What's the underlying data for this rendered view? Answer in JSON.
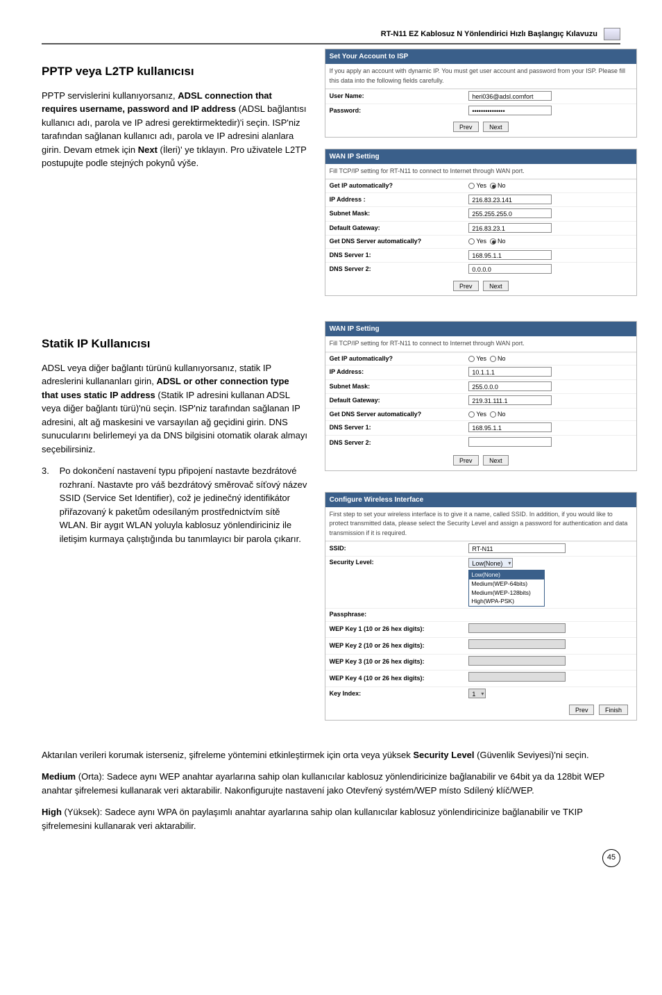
{
  "header": {
    "title": "RT-N11 EZ Kablosuz N Yönlendirici Hızlı Başlangıç Kılavuzu"
  },
  "section1": {
    "heading": "PPTP veya L2TP kullanıcısı",
    "para": "PPTP servislerini kullanıyorsanız, ADSL connection that requires username, password and IP address (ADSL bağlantısı kullanıcı adı, parola ve IP adresi gerektirmektedir)'i seçin. ISP'niz tarafından sağlanan kullanıcı adı, parola ve IP adresini alanlara girin. Devam etmek için Next (İleri)' ye tıklayın. Pro uživatele L2TP postupujte podle stejných pokynů výše.",
    "bold_phrases": {
      "b1": "ADSL connection that requires username, password and IP address",
      "b2": "Next"
    }
  },
  "panel_isp": {
    "title": "Set Your Account to ISP",
    "desc": "If you apply an account with dynamic IP. You must get user account and password from your ISP. Please fill this data into the following fields carefully.",
    "row1_lbl": "User Name:",
    "row1_val": "heri036@adsl.comfort",
    "row2_lbl": "Password:",
    "row2_val": "•••••••••••••••",
    "btn_prev": "Prev",
    "btn_next": "Next"
  },
  "panel_wan1": {
    "title": "WAN IP Setting",
    "desc": "Fill TCP/IP setting for RT-N11 to connect to Internet through WAN port.",
    "r1_lbl": "Get IP automatically?",
    "r1_yes": "Yes",
    "r1_no": "No",
    "r2_lbl": "IP Address :",
    "r2_val": "216.83.23.141",
    "r3_lbl": "Subnet Mask:",
    "r3_val": "255.255.255.0",
    "r4_lbl": "Default Gateway:",
    "r4_val": "216.83.23.1",
    "r5_lbl": "Get DNS Server automatically?",
    "r6_lbl": "DNS Server 1:",
    "r6_val": "168.95.1.1",
    "r7_lbl": "DNS Server 2:",
    "r7_val": "0.0.0.0",
    "btn_prev": "Prev",
    "btn_next": "Next"
  },
  "section2": {
    "heading": "Statik IP Kullanıcısı",
    "para": "ADSL veya diğer bağlantı türünü kullanıyorsanız, statik IP adreslerini kullananları girin, ADSL or other connection type that uses static IP address (Statik IP adresini kullanan ADSL veya diğer bağlantı türü)'nü seçin. ISP'niz tarafından sağlanan IP adresini, alt ağ maskesini ve varsayılan ağ geçidini girin. DNS sunucularını belirlemeyi ya da DNS bilgisini otomatik olarak almayı seçebilirsiniz.",
    "bold_phrase": "ADSL or other connection type that uses static IP address"
  },
  "panel_wan2": {
    "title": "WAN IP Setting",
    "desc": "Fill TCP/IP setting for RT-N11 to connect to Internet through WAN port.",
    "r1_lbl": "Get IP automatically?",
    "yes": "Yes",
    "no": "No",
    "r2_lbl": "IP Address:",
    "r2_val": "10.1.1.1",
    "r3_lbl": "Subnet Mask:",
    "r3_val": "255.0.0.0",
    "r4_lbl": "Default Gateway:",
    "r4_val": "219.31.111.1",
    "r5_lbl": "Get DNS Server automatically?",
    "r6_lbl": "DNS Server 1:",
    "r6_val": "168.95.1.1",
    "r7_lbl": "DNS Server 2:",
    "r7_val": "",
    "btn_prev": "Prev",
    "btn_next": "Next"
  },
  "item3": {
    "num": "3.",
    "text": "Po dokončení nastavení typu připojení nastavte bezdrátové rozhraní. Nastavte pro váš bezdrátový směrovač síťový název SSID (Service Set Identifier), což je jedinečný identifikátor přiřazovaný k paketům odesílaným prostřednictvím sítě WLAN. Bir aygıt WLAN yoluyla kablosuz yönlendiriciniz ile iletişim kurmaya çalıştığında bu tanımlayıcı bir parola çıkarır."
  },
  "panel_wifi": {
    "title": "Configure Wireless Interface",
    "desc": "First step to set your wireless interface is to give it a name, called SSID. In addition, if you would like to protect transmitted data, please select the Security Level and assign a password for authentication and data transmission if it is required.",
    "r1_lbl": "SSID:",
    "r1_val": "RT-N11",
    "r2_lbl": "Security Level:",
    "r2_val": "Low(None)",
    "dd_opts": [
      "Low(None)",
      "Medium(WEP-64bits)",
      "Medium(WEP-128bits)",
      "High(WPA-PSK)"
    ],
    "r3_lbl": "Passphrase:",
    "r4_lbl": "WEP Key 1 (10 or 26 hex digits):",
    "r5_lbl": "WEP Key 2 (10 or 26 hex digits):",
    "r6_lbl": "WEP Key 3 (10 or 26 hex digits):",
    "r7_lbl": "WEP Key 4 (10 or 26 hex digits):",
    "r8_lbl": "Key Index:",
    "r8_val": "1",
    "btn_prev": "Prev",
    "btn_finish": "Finish"
  },
  "bottom": {
    "p1a": "Aktarılan verileri korumak isterseniz, şifreleme yöntemini etkinleştirmek için orta veya yüksek ",
    "p1b": "Security Level",
    "p1c": " (Güvenlik Seviyesi)'ni seçin.",
    "p2a": "Medium",
    "p2b": " (Orta): Sadece aynı WEP anahtar ayarlarına sahip olan kullanıcılar kablosuz yönlendiricinize bağlanabilir ve 64bit ya da 128bit WEP anahtar şifrelemesi kullanarak veri aktarabilir. Nakonfigurujte nastavení jako Otevřený systém/WEP místo Sdílený klíč/WEP.",
    "p3a": "High",
    "p3b": " (Yüksek): Sadece aynı WPA ön paylaşımlı anahtar ayarlarına sahip olan kullanıcılar kablosuz yönlendiricinize bağlanabilir ve TKIP şifrelemesini kullanarak veri aktarabilir."
  },
  "page_number": "45"
}
